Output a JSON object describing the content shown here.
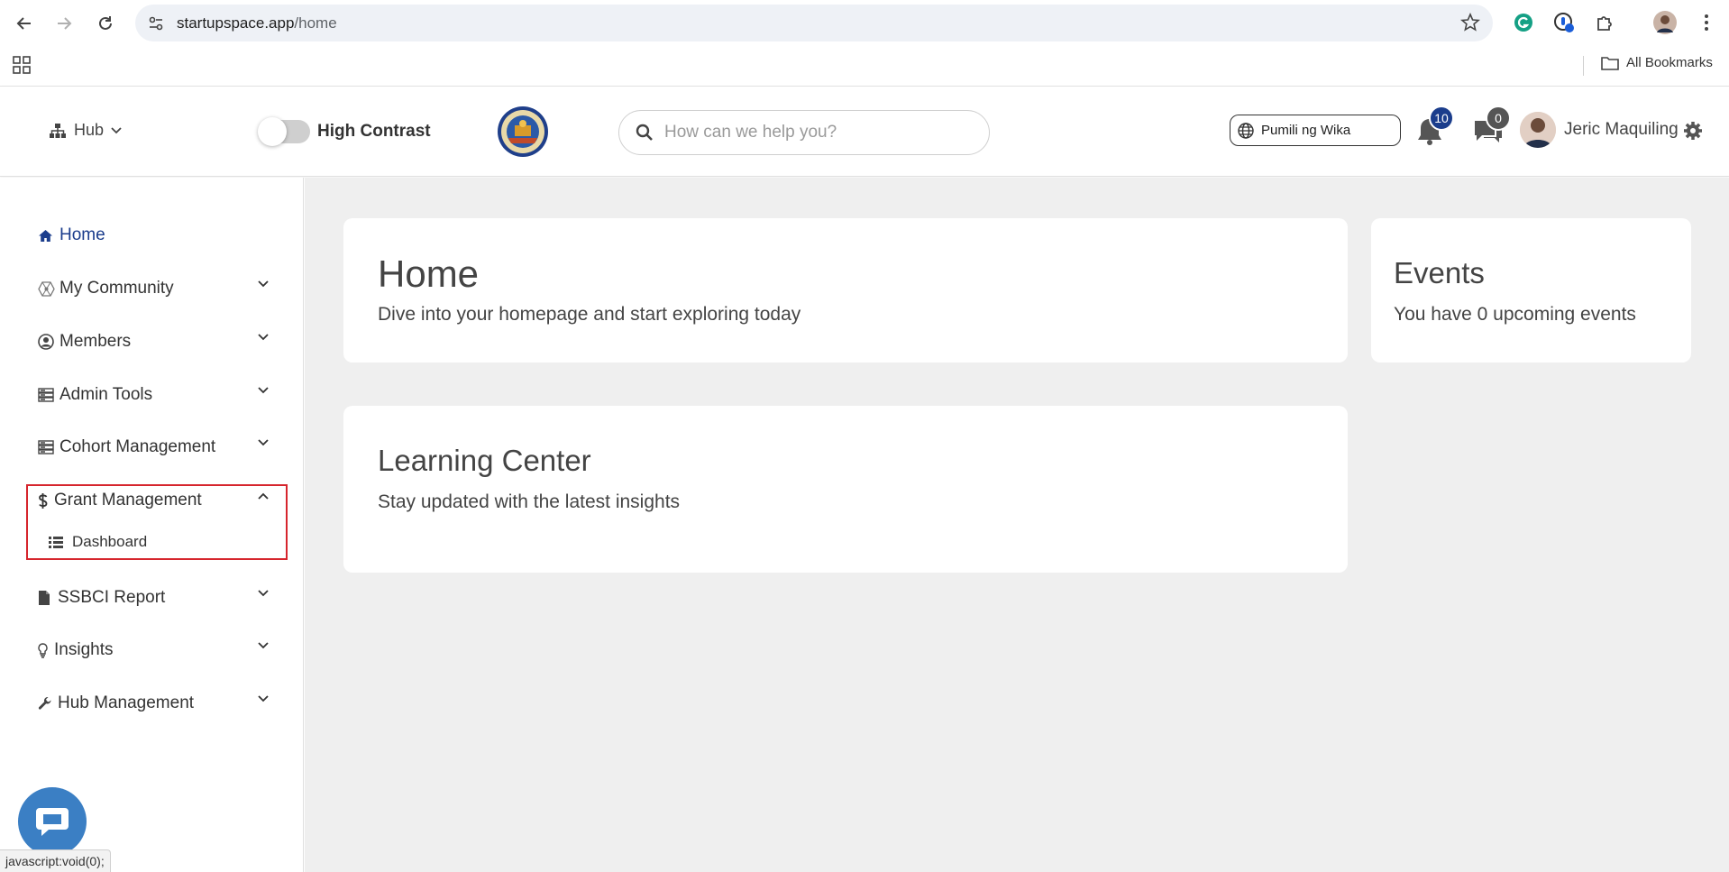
{
  "browser": {
    "url_host": "startupspace.app",
    "url_path": "/home",
    "bookmarks_label": "All Bookmarks"
  },
  "header": {
    "hub_label": "Hub",
    "high_contrast_label": "High Contrast",
    "search_placeholder": "How can we help you?",
    "language_label": "Pumili ng Wika",
    "notifications_count": "10",
    "messages_count": "0",
    "user_name": "Jeric Maquiling"
  },
  "sidebar": {
    "items": [
      {
        "label": "Home",
        "icon": "home-icon"
      },
      {
        "label": "My Community",
        "icon": "community-icon"
      },
      {
        "label": "Members",
        "icon": "user-circle-icon"
      },
      {
        "label": "Admin Tools",
        "icon": "server-icon"
      },
      {
        "label": "Cohort Management",
        "icon": "server-icon"
      },
      {
        "label": "Grant Management",
        "icon": "dollar-icon"
      },
      {
        "label": "SSBCI Report",
        "icon": "file-icon"
      },
      {
        "label": "Insights",
        "icon": "lightbulb-icon"
      },
      {
        "label": "Hub Management",
        "icon": "wrench-icon"
      }
    ],
    "grant_sub_items": [
      {
        "label": "Dashboard",
        "icon": "list-icon"
      }
    ]
  },
  "main": {
    "home_card": {
      "title": "Home",
      "subtitle": "Dive into your homepage and start exploring today"
    },
    "events_card": {
      "title": "Events",
      "subtitle": "You have 0 upcoming events"
    },
    "learning_card": {
      "title": "Learning Center",
      "subtitle": "Stay updated with the latest insights"
    }
  },
  "status_bar": {
    "text": "javascript:void(0);"
  },
  "colors": {
    "accent": "#1b3d8c",
    "highlight_border": "#d6252d",
    "main_bg": "#efefef",
    "chat_button": "#3b7fc4"
  }
}
